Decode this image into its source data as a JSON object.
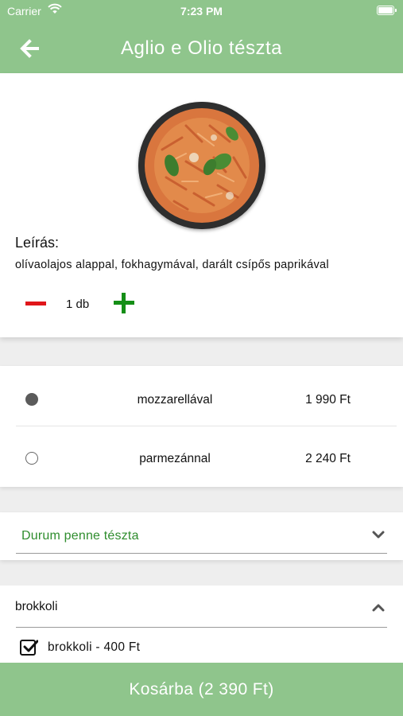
{
  "status_bar": {
    "carrier": "Carrier",
    "time": "7:23 PM"
  },
  "header": {
    "title": "Aglio e Olio tészta",
    "back_icon": "arrow-left-icon"
  },
  "dish": {
    "image": "pasta-dish-photo",
    "description_label": "Leírás:",
    "description": "olívaolajos alappal, fokhagymával, darált csípős paprikával",
    "quantity": "1 db"
  },
  "variants": [
    {
      "name": "mozzarellával",
      "price": "1 990 Ft",
      "selected": true
    },
    {
      "name": "parmezánnal",
      "price": "2 240 Ft",
      "selected": false
    }
  ],
  "pasta_select": {
    "value": "Durum penne tészta"
  },
  "extras": {
    "group_label": "brokkoli",
    "items": [
      {
        "label": "brokkoli - 400 Ft",
        "checked": true
      }
    ]
  },
  "cart_button": {
    "label": "Kosárba (2 390 Ft)"
  },
  "colors": {
    "header_green": "#8fc58c",
    "minus_red": "#e0161a",
    "plus_green": "#148e16",
    "select_text_green": "#2f8d2e"
  }
}
